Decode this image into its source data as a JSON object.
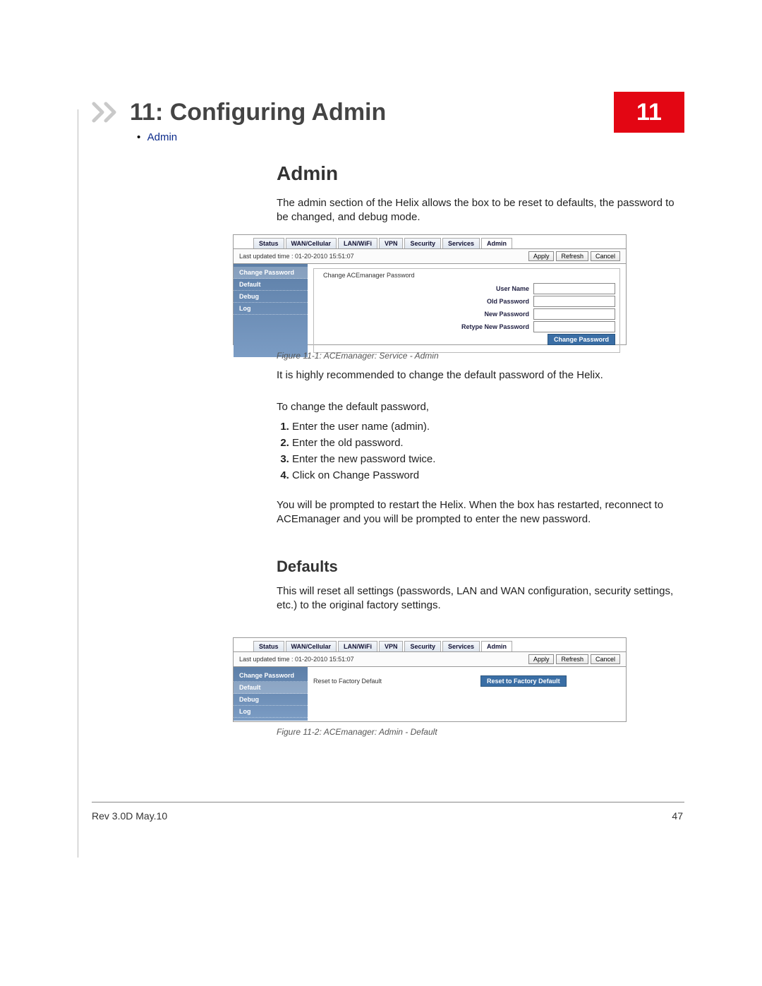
{
  "chapter": {
    "number": "11",
    "title": "11: Configuring Admin"
  },
  "toc": {
    "item0": "Admin"
  },
  "section_admin": {
    "heading": "Admin",
    "intro": "The admin section of the Helix allows the box to be reset to defaults, the password to be changed, and debug mode.",
    "recommend": "It is highly recommended to change the default password of the Helix.",
    "to_change": "To change the default password,",
    "steps": {
      "s1": "Enter the user name (admin).",
      "s2": "Enter the old password.",
      "s3": "Enter the new password twice.",
      "s4": "Click on Change Password"
    },
    "after": "You will be prompted to restart the Helix. When the box has restarted, reconnect to ACEmanager and you will be prompted to enter the new password."
  },
  "section_defaults": {
    "heading": "Defaults",
    "body": "This will reset all settings (passwords, LAN and WAN configuration, security settings, etc.) to the original factory settings."
  },
  "figure1": {
    "caption": "Figure 11-1: ACEmanager: Service - Admin",
    "tabs": {
      "t0": "Status",
      "t1": "WAN/Cellular",
      "t2": "LAN/WiFi",
      "t3": "VPN",
      "t4": "Security",
      "t5": "Services",
      "t6": "Admin"
    },
    "timestamp": "Last updated time : 01-20-2010 15:51:07",
    "buttons": {
      "apply": "Apply",
      "refresh": "Refresh",
      "cancel": "Cancel"
    },
    "side": {
      "i0": "Change Password",
      "i1": "Default",
      "i2": "Debug",
      "i3": "Log"
    },
    "fieldset_title": "Change ACEmanager Password",
    "labels": {
      "user": "User Name",
      "old": "Old Password",
      "newp": "New Password",
      "retype": "Retype New Password"
    },
    "cp_button": "Change Password"
  },
  "figure2": {
    "caption": "Figure 11-2: ACEmanager: Admin - Default",
    "tabs": {
      "t0": "Status",
      "t1": "WAN/Cellular",
      "t2": "LAN/WiFi",
      "t3": "VPN",
      "t4": "Security",
      "t5": "Services",
      "t6": "Admin"
    },
    "timestamp": "Last updated time : 01-20-2010 15:51:07",
    "buttons": {
      "apply": "Apply",
      "refresh": "Refresh",
      "cancel": "Cancel"
    },
    "side": {
      "i0": "Change Password",
      "i1": "Default",
      "i2": "Debug",
      "i3": "Log"
    },
    "reset_label": "Reset to Factory Default",
    "reset_button": "Reset to Factory Default"
  },
  "footer": {
    "left": "Rev 3.0D  May.10",
    "right": "47"
  }
}
